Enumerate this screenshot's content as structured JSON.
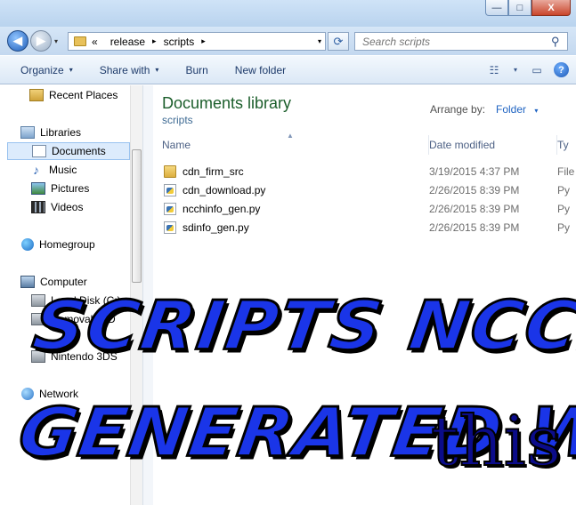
{
  "window": {
    "caption_buttons": {
      "minimize": "—",
      "maximize": "□",
      "close": "X"
    }
  },
  "address_bar": {
    "back_glyph": "◀",
    "forward_glyph": "▶",
    "history_glyph": "▾",
    "overflow": "«",
    "crumbs": [
      "release",
      "scripts"
    ],
    "separator": "▸",
    "dropdown_glyph": "▾",
    "refresh_glyph": "⟳",
    "search_placeholder": "Search scripts",
    "search_glyph": "⚲"
  },
  "command_bar": {
    "organize": "Organize",
    "share_with": "Share with",
    "burn": "Burn",
    "new_folder": "New folder",
    "dropdown_glyph": "▾",
    "view_glyph": "☷",
    "preview_glyph": "▭",
    "help_glyph": "?"
  },
  "nav_pane": {
    "recent_places": "Recent Places",
    "libraries": "Libraries",
    "documents": "Documents",
    "music": "Music",
    "music_glyph": "♪",
    "pictures": "Pictures",
    "videos": "Videos",
    "homegroup": "Homegroup",
    "computer": "Computer",
    "local_disk": "Local Disk (C:)",
    "removable": "Removable D",
    "nintendo": "Nintendo 3DS",
    "network": "Network"
  },
  "content": {
    "library_title": "Documents library",
    "library_subtitle": "scripts",
    "arrange_by_label": "Arrange by:",
    "arrange_by_value": "Folder",
    "arrange_glyph": "▾",
    "sort_glyph": "▲",
    "columns": {
      "name": "Name",
      "date_modified": "Date modified",
      "type": "Ty"
    },
    "files": [
      {
        "name": "cdn_firm_src",
        "date": "3/19/2015 4:37 PM",
        "type": "File",
        "kind": "folder"
      },
      {
        "name": "cdn_download.py",
        "date": "2/26/2015 8:39 PM",
        "type": "Py",
        "kind": "py"
      },
      {
        "name": "ncchinfo_gen.py",
        "date": "2/26/2015 8:39 PM",
        "type": "Py",
        "kind": "py"
      },
      {
        "name": "sdinfo_gen.py",
        "date": "2/26/2015 8:39 PM",
        "type": "Py",
        "kind": "py"
      }
    ]
  },
  "overlay": {
    "line1": "SCRIPTS NCCHINFO",
    "line2": "GENERATED W/",
    "line3": "this"
  }
}
